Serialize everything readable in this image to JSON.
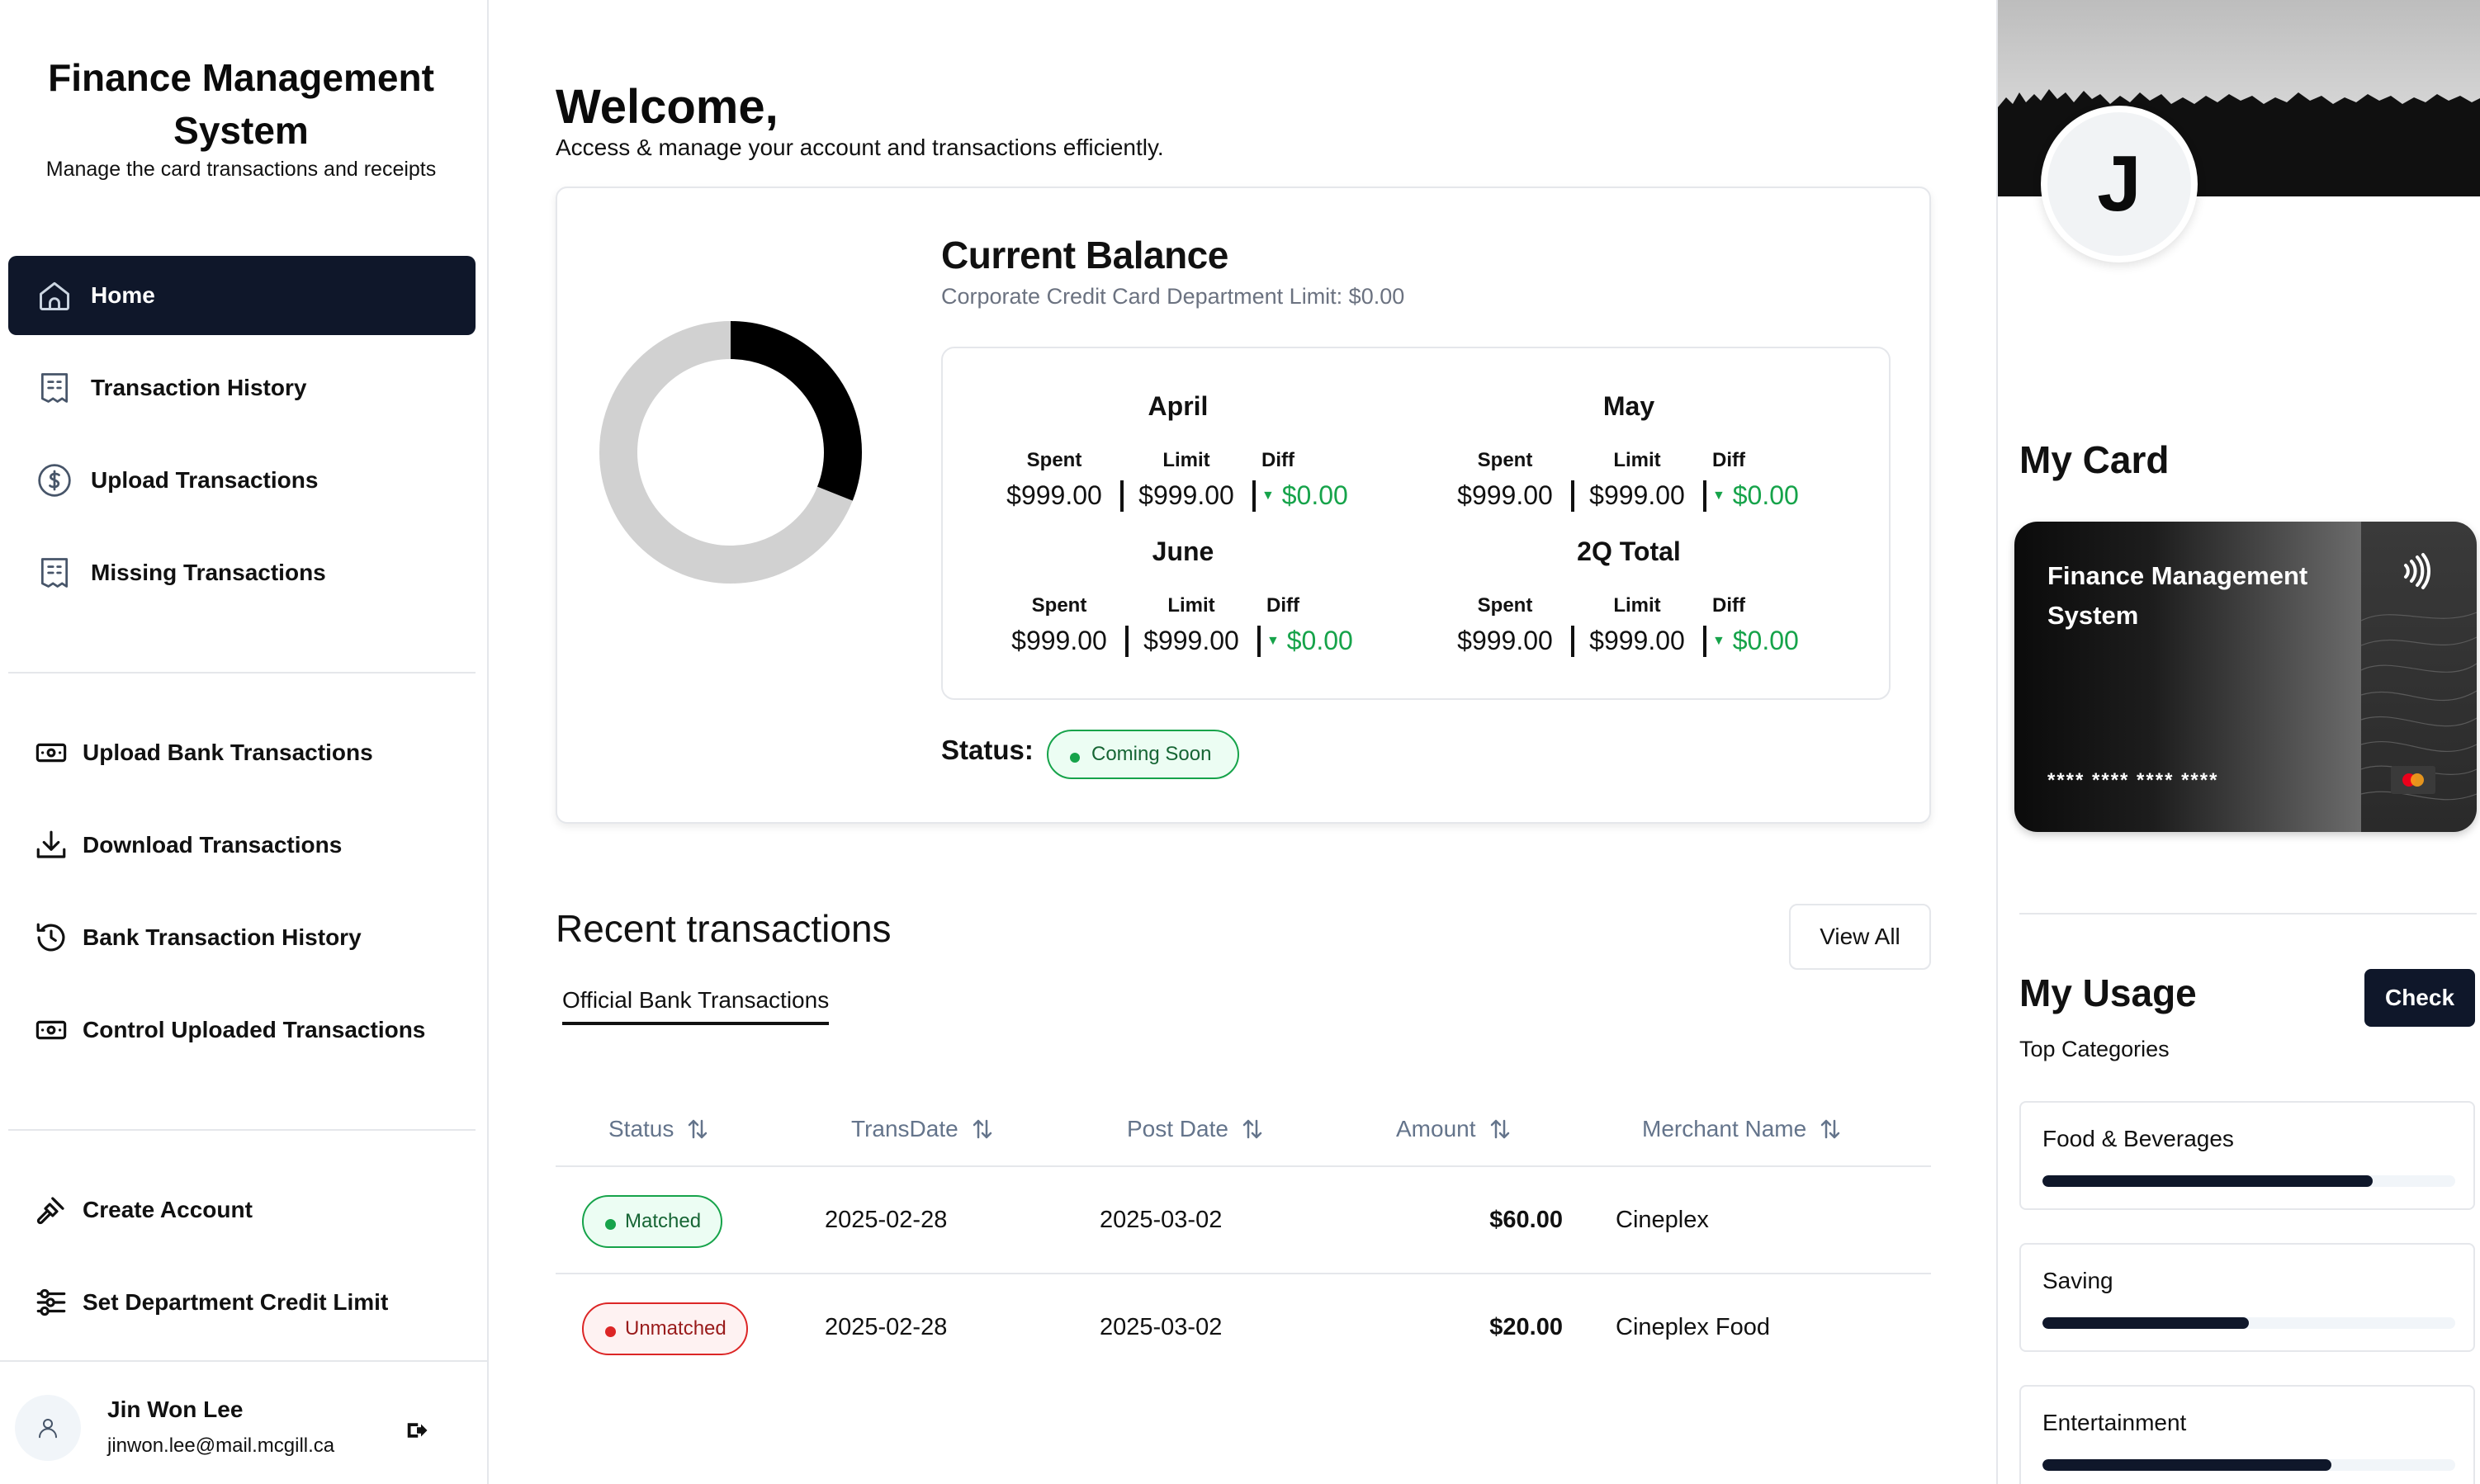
{
  "brand": {
    "title": "Finance Management System",
    "subtitle": "Manage the card transactions and receipts"
  },
  "nav_primary": [
    {
      "label": "Home",
      "icon": "home-icon",
      "active": true
    },
    {
      "label": "Transaction History",
      "icon": "receipt-icon"
    },
    {
      "label": "Upload Transactions",
      "icon": "dollar-circle-icon"
    },
    {
      "label": "Missing Transactions",
      "icon": "receipt-icon"
    }
  ],
  "nav_bank": [
    {
      "label": "Upload Bank Transactions",
      "icon": "banknote-icon"
    },
    {
      "label": "Download Transactions",
      "icon": "download-icon"
    },
    {
      "label": "Bank Transaction History",
      "icon": "history-icon"
    },
    {
      "label": "Control Uploaded Transactions",
      "icon": "banknote-icon"
    }
  ],
  "nav_admin": [
    {
      "label": "Create Account",
      "icon": "gavel-icon"
    },
    {
      "label": "Set Department Credit Limit",
      "icon": "sliders-icon"
    }
  ],
  "user": {
    "name": "Jin Won Lee",
    "email": "jinwon.lee@mail.mcgill.ca"
  },
  "header": {
    "title": "Welcome,",
    "subtitle": "Access & manage your account and transactions efficiently."
  },
  "balance": {
    "title": "Current Balance",
    "subtitle": "Corporate Credit Card Department Limit: $0.00",
    "donut_fraction": 0.31,
    "colors": {
      "used": "#000000",
      "remaining": "#d1d1d1"
    },
    "col_labels": {
      "spent": "Spent",
      "limit": "Limit",
      "diff": "Diff"
    },
    "periods": [
      {
        "name": "April",
        "spent": "$999.00",
        "limit": "$999.00",
        "diff": "$0.00"
      },
      {
        "name": "May",
        "spent": "$999.00",
        "limit": "$999.00",
        "diff": "$0.00"
      },
      {
        "name": "June",
        "spent": "$999.00",
        "limit": "$999.00",
        "diff": "$0.00"
      },
      {
        "name": "2Q Total",
        "spent": "$999.00",
        "limit": "$999.00",
        "diff": "$0.00"
      }
    ],
    "status_label": "Status:",
    "status_value": "Coming Soon"
  },
  "recent": {
    "title": "Recent transactions",
    "view_all": "View All",
    "tab": "Official Bank Transactions",
    "columns": [
      "Status",
      "TransDate",
      "Post Date",
      "Amount",
      "Merchant Name"
    ],
    "rows": [
      {
        "status": "Matched",
        "trans_date": "2025-02-28",
        "post_date": "2025-03-02",
        "amount": "$60.00",
        "merchant": "Cineplex"
      },
      {
        "status": "Unmatched",
        "trans_date": "2025-02-28",
        "post_date": "2025-03-02",
        "amount": "$20.00",
        "merchant": "Cineplex Food"
      }
    ]
  },
  "profile": {
    "initial": "J"
  },
  "card": {
    "section_title": "My Card",
    "name": "Finance Management System",
    "number": "**** **** **** ****"
  },
  "usage": {
    "title": "My Usage",
    "check": "Check",
    "subtitle": "Top Categories",
    "categories": [
      {
        "label": "Food & Beverages",
        "fraction": 0.8
      },
      {
        "label": "Saving",
        "fraction": 0.5
      },
      {
        "label": "Entertainment",
        "fraction": 0.7
      }
    ]
  }
}
